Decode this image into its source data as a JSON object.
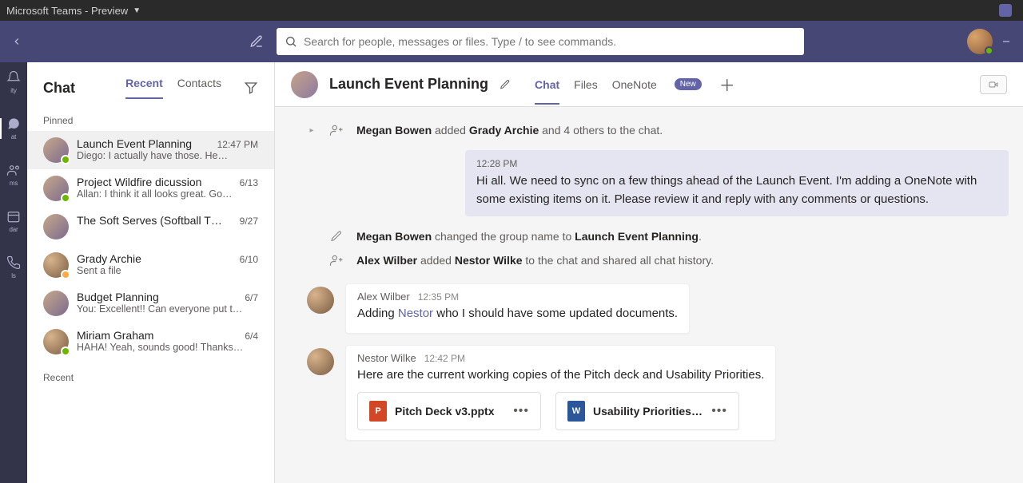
{
  "titlebar": {
    "title": "Microsoft Teams - Preview"
  },
  "search": {
    "placeholder": "Search for people, messages or files. Type / to see commands."
  },
  "rail": {
    "items": [
      {
        "key": "activity",
        "label": "ity"
      },
      {
        "key": "chat",
        "label": "at"
      },
      {
        "key": "teams",
        "label": "ms"
      },
      {
        "key": "calendar",
        "label": "dar"
      },
      {
        "key": "calls",
        "label": "ls"
      }
    ]
  },
  "chatlist": {
    "heading": "Chat",
    "tabs": {
      "recent": "Recent",
      "contacts": "Contacts"
    },
    "section_pinned": "Pinned",
    "section_recent": "Recent",
    "items": [
      {
        "name": "Launch Event Planning",
        "time": "12:47 PM",
        "preview": "Diego: I actually have those. He…",
        "group": true,
        "badge": "available"
      },
      {
        "name": "Project Wildfire dicussion",
        "time": "6/13",
        "preview": "Allan: I think it all looks great. Go…",
        "group": true,
        "badge": "available"
      },
      {
        "name": "The Soft Serves (Softball T…",
        "time": "9/27",
        "preview": "",
        "group": true
      },
      {
        "name": "Grady Archie",
        "time": "6/10",
        "preview": "Sent a file",
        "group": false,
        "badge": "away"
      },
      {
        "name": "Budget Planning",
        "time": "6/7",
        "preview": "You: Excellent!! Can everyone put t…",
        "group": true
      },
      {
        "name": "Miriam Graham",
        "time": "6/4",
        "preview": "HAHA! Yeah, sounds good! Thanks…",
        "group": false,
        "badge": "available"
      }
    ]
  },
  "conv": {
    "title": "Launch Event Planning",
    "tabs": {
      "chat": "Chat",
      "files": "Files",
      "onenote": "OneNote",
      "new": "New"
    },
    "sys1_a": "Megan Bowen",
    "sys1_b": " added ",
    "sys1_c": "Grady Archie",
    "sys1_d": " and 4 others to the chat.",
    "self_ts": "12:28 PM",
    "self_msg": "Hi all.  We need to sync on a few things ahead of the Launch Event.  I'm adding a OneNote with some existing items on it.  Please review it and reply with any comments or questions.",
    "sys2_a": "Megan Bowen",
    "sys2_b": " changed the group name to ",
    "sys2_c": "Launch Event Planning",
    "sys2_d": ".",
    "sys3_a": "Alex Wilber",
    "sys3_b": " added ",
    "sys3_c": "Nestor Wilke",
    "sys3_d": " to the chat and shared all chat history.",
    "m1_author": "Alex Wilber",
    "m1_ts": "12:35 PM",
    "m1_pre": "Adding ",
    "m1_mention": "Nestor",
    "m1_post": " who I should have some updated documents.",
    "m2_author": "Nestor Wilke",
    "m2_ts": "12:42 PM",
    "m2_body": "Here are the current working copies of the Pitch deck and Usability Priorities.",
    "att1_name": "Pitch Deck v3.pptx",
    "att1_type": "P",
    "att2_name": "Usability Priorities.d…",
    "att2_type": "W"
  }
}
